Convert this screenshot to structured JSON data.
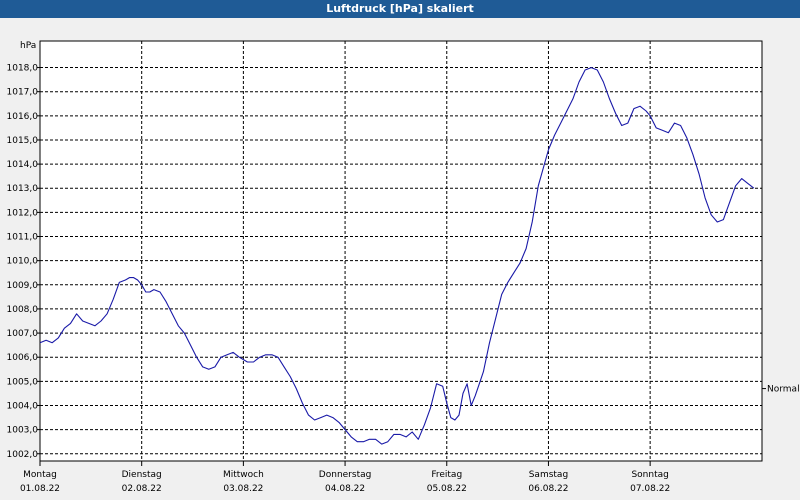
{
  "window": {
    "title": "Luftdruck [hPa] skaliert"
  },
  "chart_data": {
    "type": "line",
    "title": "Luftdruck [hPa] skaliert",
    "ylabel": "hPa",
    "xlabel": "",
    "ylim": [
      1001.7,
      1019.1
    ],
    "xlim": [
      0,
      7.1
    ],
    "grid": true,
    "line_color": "#1a1aa8",
    "yticks": [
      1002.0,
      1003.0,
      1004.0,
      1005.0,
      1006.0,
      1007.0,
      1008.0,
      1009.0,
      1010.0,
      1011.0,
      1012.0,
      1013.0,
      1014.0,
      1015.0,
      1016.0,
      1017.0,
      1018.0
    ],
    "ytick_labels": [
      "1002,0",
      "1003,0",
      "1004,0",
      "1005,0",
      "1006,0",
      "1007,0",
      "1008,0",
      "1009,0",
      "1010,0",
      "1011,0",
      "1012,0",
      "1013,0",
      "1014,0",
      "1015,0",
      "1016,0",
      "1017,0",
      "1018,0"
    ],
    "xticks": [
      {
        "x": 0,
        "day": "Montag",
        "date": "01.08.22"
      },
      {
        "x": 1,
        "day": "Dienstag",
        "date": "02.08.22"
      },
      {
        "x": 2,
        "day": "Mittwoch",
        "date": "03.08.22"
      },
      {
        "x": 3,
        "day": "Donnerstag",
        "date": "04.08.22"
      },
      {
        "x": 4,
        "day": "Freitag",
        "date": "05.08.22"
      },
      {
        "x": 5,
        "day": "Samstag",
        "date": "06.08.22"
      },
      {
        "x": 6,
        "day": "Sonntag",
        "date": "07.08.22"
      }
    ],
    "reference": {
      "label": "Normal",
      "value": 1004.7
    },
    "series": [
      {
        "x": [
          0.0,
          0.06,
          0.12,
          0.18,
          0.24,
          0.3,
          0.36,
          0.42,
          0.48,
          0.54,
          0.6,
          0.66,
          0.72,
          0.78,
          0.84,
          0.88,
          0.92,
          0.96,
          1.0,
          1.04,
          1.08,
          1.12,
          1.18,
          1.24,
          1.3,
          1.36,
          1.42,
          1.48,
          1.54,
          1.6,
          1.66,
          1.72,
          1.78,
          1.84,
          1.9,
          1.96,
          2.0,
          2.04,
          2.1,
          2.16,
          2.22,
          2.28,
          2.34,
          2.4,
          2.46,
          2.52,
          2.58,
          2.64,
          2.7,
          2.76,
          2.82,
          2.88,
          2.94,
          3.0,
          3.06,
          3.12,
          3.18,
          3.24,
          3.3,
          3.36,
          3.42,
          3.48,
          3.54,
          3.6,
          3.66,
          3.72,
          3.78,
          3.84,
          3.9,
          3.96,
          4.0,
          4.04,
          4.08,
          4.12,
          4.16,
          4.2,
          4.24,
          4.28,
          4.32,
          4.36,
          4.42,
          4.48,
          4.54,
          4.6,
          4.66,
          4.72,
          4.78,
          4.84,
          4.9,
          4.96,
          5.0,
          5.06,
          5.12,
          5.18,
          5.24,
          5.3,
          5.36,
          5.42,
          5.48,
          5.54,
          5.6,
          5.66,
          5.72,
          5.78,
          5.84,
          5.9,
          5.96,
          6.0,
          6.06,
          6.12,
          6.18,
          6.24,
          6.3,
          6.36,
          6.42,
          6.48,
          6.54,
          6.6,
          6.66,
          6.72,
          6.78,
          6.84,
          6.9,
          6.96,
          7.02
        ],
        "y": [
          1006.6,
          1006.7,
          1006.6,
          1006.8,
          1007.2,
          1007.4,
          1007.8,
          1007.5,
          1007.4,
          1007.3,
          1007.5,
          1007.8,
          1008.4,
          1009.1,
          1009.2,
          1009.3,
          1009.3,
          1009.2,
          1009.0,
          1008.7,
          1008.7,
          1008.8,
          1008.7,
          1008.3,
          1007.8,
          1007.3,
          1007.0,
          1006.5,
          1006.0,
          1005.6,
          1005.5,
          1005.6,
          1006.0,
          1006.1,
          1006.2,
          1006.0,
          1005.9,
          1005.8,
          1005.8,
          1006.0,
          1006.1,
          1006.1,
          1006.0,
          1005.6,
          1005.2,
          1004.7,
          1004.1,
          1003.6,
          1003.4,
          1003.5,
          1003.6,
          1003.5,
          1003.3,
          1003.0,
          1002.7,
          1002.5,
          1002.5,
          1002.6,
          1002.6,
          1002.4,
          1002.5,
          1002.8,
          1002.8,
          1002.7,
          1002.9,
          1002.6,
          1003.2,
          1003.9,
          1004.9,
          1004.8,
          1004.1,
          1003.5,
          1003.4,
          1003.6,
          1004.5,
          1004.9,
          1004.0,
          1004.4,
          1004.9,
          1005.4,
          1006.6,
          1007.6,
          1008.6,
          1009.1,
          1009.5,
          1009.9,
          1010.5,
          1011.6,
          1013.1,
          1014.0,
          1014.6,
          1015.2,
          1015.7,
          1016.2,
          1016.7,
          1017.4,
          1017.9,
          1018.0,
          1017.9,
          1017.4,
          1016.7,
          1016.1,
          1015.6,
          1015.7,
          1016.3,
          1016.4,
          1016.2,
          1016.0,
          1015.5,
          1015.4,
          1015.3,
          1015.7,
          1015.6,
          1015.1,
          1014.4,
          1013.6,
          1012.6,
          1011.9,
          1011.6,
          1011.7,
          1012.4,
          1013.1,
          1013.4,
          1013.2,
          1013.0
        ]
      }
    ]
  }
}
